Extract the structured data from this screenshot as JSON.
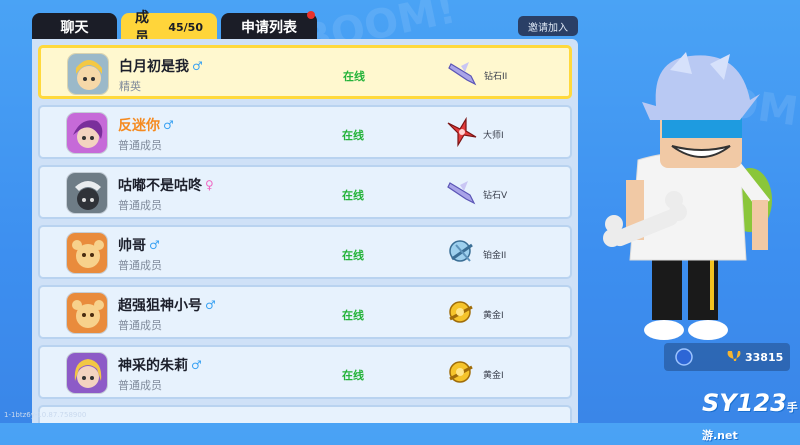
{
  "tabs": [
    {
      "label": "聊天"
    },
    {
      "label": "成员",
      "count": "45/50"
    },
    {
      "label": "申请列表"
    }
  ],
  "invite_button": "邀请加入",
  "members": [
    {
      "name": "白月初是我",
      "gender": "male",
      "gender_icon": "♂",
      "role": "精英",
      "status": "在线",
      "rank": "钻石II",
      "rank_icon": "diamond-rank-icon",
      "selected": true
    },
    {
      "name": "反迷你",
      "gender": "male",
      "gender_icon": "♂",
      "role": "普通成员",
      "status": "在线",
      "rank": "大师I",
      "rank_icon": "master-rank-icon",
      "selected": false
    },
    {
      "name": "咕嘟不是咕咚",
      "gender": "female",
      "gender_icon": "♀",
      "role": "普通成员",
      "status": "在线",
      "rank": "钻石V",
      "rank_icon": "diamond-rank-icon",
      "selected": false
    },
    {
      "name": "帅哥",
      "gender": "male",
      "gender_icon": "♂",
      "role": "普通成员",
      "status": "在线",
      "rank": "铂金II",
      "rank_icon": "platinum-rank-icon",
      "selected": false
    },
    {
      "name": "超强狙神小号",
      "gender": "male",
      "gender_icon": "♂",
      "role": "普通成员",
      "status": "在线",
      "rank": "黄金I",
      "rank_icon": "gold-rank-icon",
      "selected": false
    },
    {
      "name": "神采的朱莉",
      "gender": "male",
      "gender_icon": "♂",
      "role": "普通成员",
      "status": "在线",
      "rank": "黄金I",
      "rank_icon": "gold-rank-icon",
      "selected": false
    }
  ],
  "player": {
    "trophies": "33815"
  },
  "uid_text": "1-1btz6y-10.87.758900",
  "watermark": {
    "brand": "SY123",
    "sub": "手游",
    "domain": ".net"
  },
  "colors": {
    "tab_active": "#ffd53a",
    "tab_inactive": "#1b1d27",
    "online": "#25b33a",
    "selected_border": "#ffd93c",
    "name_highlight": "#f58a1f"
  }
}
